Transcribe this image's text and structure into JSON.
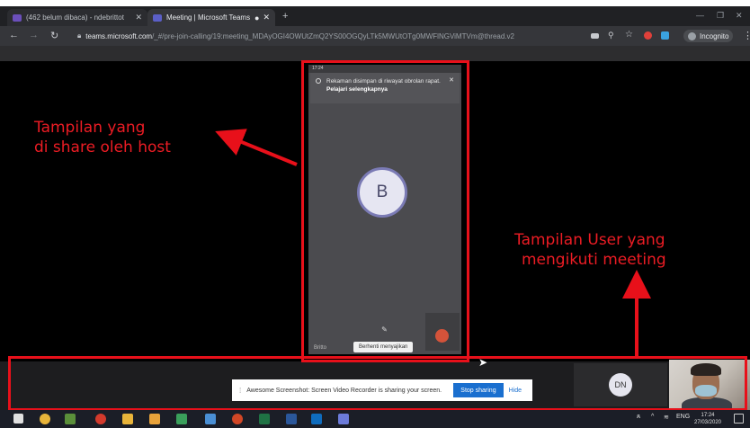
{
  "browser": {
    "tabs": [
      {
        "title": "(462 belum dibaca) - ndebrittot",
        "color": "#6b4fbb"
      },
      {
        "title": "Meeting | Microsoft Teams",
        "color": "#5b5fc7"
      }
    ],
    "new_tab": "+",
    "url_host": "teams.microsoft.com",
    "url_path": "/_#/pre-join-calling/19:meeting_MDAyOGI4OWUtZmQ2YS00OGQyLTk5MWUtOTg0MWFlNGViMTVm@thread.v2",
    "incognito_label": "Incognito"
  },
  "shared_screen": {
    "status_time": "17:24",
    "banner_text": "Rekaman disimpan di riwayat obrolan rapat.",
    "banner_link": "Pelajari selengkapnya",
    "avatar_initial": "B",
    "bottom_left": "Britto",
    "stop_presenting": "Berhenti menyajikan"
  },
  "annotations": {
    "host_line1": "Tampilan yang",
    "host_line2": "di share oleh host",
    "user_line1": "Tampilan User yang",
    "user_line2": "mengikuti meeting",
    "color": "#e8101a"
  },
  "share_bar": {
    "message": "Awesome Screenshot: Screen Video Recorder is sharing your screen.",
    "stop_label": "Stop sharing",
    "hide_label": "Hide"
  },
  "participants": {
    "dn_initials": "DN"
  },
  "taskbar": {
    "lang": "ENG",
    "time": "17:24",
    "date": "27/03/2020"
  }
}
